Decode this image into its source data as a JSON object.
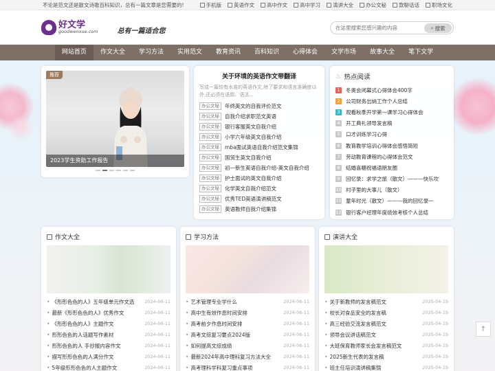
{
  "topbar": {
    "notice": "不论是范文还是散文诗歌百科知识，总有一篇文章是您需要的!",
    "links": [
      "手机版",
      "英语作文",
      "高中作文",
      "高中学习",
      "演讲大全",
      "办公文秘",
      "款聊话话",
      "职场文化"
    ]
  },
  "header": {
    "logo_cn": "好文学",
    "logo_en": "goodwenxue.com",
    "slogan": "总有一篇适合您",
    "search_placeholder": "在这里搜索您感兴趣的内容",
    "search_button": "搜索"
  },
  "nav": [
    "网站首页",
    "作文大全",
    "学习方法",
    "实用范文",
    "教育资讯",
    "百科知识",
    "心得体会",
    "文学市场",
    "故事大全",
    "笔下文学"
  ],
  "slider": {
    "badge": "推荐",
    "caption": "2023学生资助工作报告"
  },
  "featured": {
    "title": "关于环境的英语作文带翻译",
    "summary": "写成一篇较有水准的英语作文,除了要求和语言准确度以外,还必须在语用、语法...",
    "tag": "办公文秘",
    "items": [
      "年终英文的自我评价范文",
      "自我介绍求职范文英语",
      "银行客服英文自我介绍",
      "小学六年级英文自我介绍",
      "mba面试英语自我介绍范文集锦",
      "国贸生英文自我介绍",
      "初一新生英语自我介绍-英文自我介绍",
      "护士面试的英文自我介绍",
      "化学英文自我介绍范文",
      "优秀TED英语演讲稿范文",
      "英语教师自我介绍集锦"
    ]
  },
  "hot": {
    "title": "热点阅读",
    "items": [
      "冬奥会闭幕式心得体会400字",
      "公司财务出纳工作个人总结",
      "观看秋季开学第一课学习心得体会",
      "开工典礼领导发言稿",
      "口才训练学习心得",
      "教育教学培训心得体会感悟简短",
      "劳动教育课程的心得体会范文",
      "结婚喜糖祝福语朋友圈",
      "回忆录：求学之旅（散文）———快乐坎",
      "村子里的大事儿（散文）",
      "童年时光（散文）———我的回忆录一",
      "银行客户经理年度绩效考核个人总结"
    ]
  },
  "columns": [
    {
      "title": "作文大全",
      "items": [
        {
          "t": "《形形色色的人》五年级单元作文选",
          "d": "2024-06-11"
        },
        {
          "t": "最新《形形色色的人》优秀作文",
          "d": "2024-06-11"
        },
        {
          "t": "《形形色色的人》主题作文",
          "d": "2024-06-11"
        },
        {
          "t": "形形色色的人话题写作素材",
          "d": "2024-06-11"
        },
        {
          "t": "形形色色的人 手抄报内容作文",
          "d": "2024-06-11"
        },
        {
          "t": "描写形形色色的人满分作文",
          "d": "2024-06-11"
        },
        {
          "t": "5年级形形色色的人主题作文",
          "d": "2024-06-11"
        }
      ]
    },
    {
      "title": "学习方法",
      "items": [
        {
          "t": "艺术管理专业学什么",
          "d": "2024-06-11"
        },
        {
          "t": "高中生有效作息时间安排",
          "d": "2024-06-11"
        },
        {
          "t": "高考前夕作息时间安排",
          "d": "2024-06-11"
        },
        {
          "t": "高考文综复习要点2024版",
          "d": "2024-06-11"
        },
        {
          "t": "如何提高文综成绩",
          "d": "2024-06-11"
        },
        {
          "t": "最新2024年高中理科复习方法大全",
          "d": "2024-06-11"
        },
        {
          "t": "高考理科学科复习重点事项",
          "d": "2024-06-11"
        }
      ]
    },
    {
      "title": "演讲大全",
      "items": [
        {
          "t": "关于新教师的发言稿范文",
          "d": "2025-04-19"
        },
        {
          "t": "校长对食品安全的发言稿",
          "d": "2025-04-19"
        },
        {
          "t": "高三经验交流发言稿范文",
          "d": "2025-04-19"
        },
        {
          "t": "领导会议讲话稿范文",
          "d": "2025-04-19"
        },
        {
          "t": "大班保育教师家长会发言稿范文",
          "d": "2025-04-19"
        },
        {
          "t": "2025新生代表的发言稿",
          "d": "2025-04-19"
        },
        {
          "t": "班主任培训演讲稿集锦",
          "d": "2025-04-19"
        }
      ]
    }
  ],
  "colors": {
    "nav_bg": "#7d6e66",
    "brand": "#6b2f8e"
  }
}
